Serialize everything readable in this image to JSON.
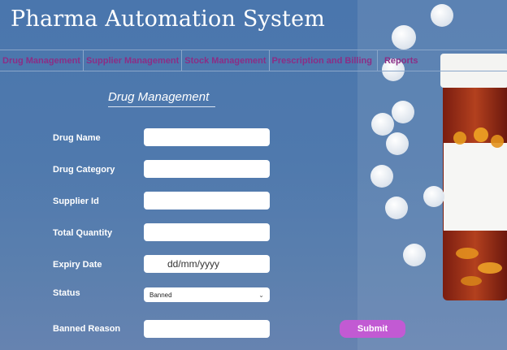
{
  "app": {
    "title": "Pharma Automation System"
  },
  "nav": {
    "items": [
      {
        "label": "Drug Management"
      },
      {
        "label": "Supplier Management"
      },
      {
        "label": "Stock Management"
      },
      {
        "label": "Prescription and Billing"
      },
      {
        "label": "Reports"
      }
    ]
  },
  "form": {
    "title": "Drug Management",
    "labels": {
      "drug_name": "Drug  Name",
      "drug_category": "Drug Category",
      "supplier_id": "Supplier Id",
      "total_quantity": "Total Quantity",
      "expiry_date": "Expiry Date",
      "status": "Status",
      "banned_reason": "Banned Reason"
    },
    "values": {
      "drug_name": "",
      "drug_category": "",
      "supplier_id": "",
      "total_quantity": "",
      "expiry_date": "dd/mm/yyyy",
      "status": "Banned",
      "banned_reason": ""
    },
    "submit_label": "Submit"
  },
  "colors": {
    "nav_text": "#8b2e86",
    "submit_bg": "#c25ad3",
    "background": "#4f79ad"
  },
  "icons": {
    "select_arrow": "chevron-down-icon"
  }
}
